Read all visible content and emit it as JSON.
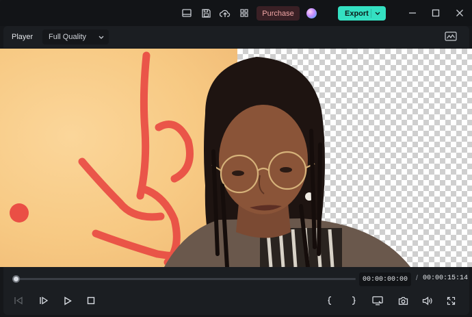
{
  "titlebar": {
    "purchase_label": "Purchase",
    "export_label": "Export",
    "icons": [
      "layout-icon",
      "save-icon",
      "cloud-upload-icon",
      "grid-icon",
      "avatar-orb-icon"
    ],
    "window_controls": [
      "minimize-icon",
      "maximize-icon",
      "close-icon"
    ]
  },
  "player": {
    "label": "Player",
    "quality": "Full Quality"
  },
  "preview": {
    "description_icon": "background-removed-preview"
  },
  "playback": {
    "current_time": "00:00:00:00",
    "separator": "/",
    "total_time": "00:00:15:14",
    "progress_fraction": 0.0
  },
  "colors": {
    "accent": "#34e0c2",
    "purchase_bg": "#3a2025",
    "purchase_text": "#f2a6a6",
    "panel": "#1b1e22"
  }
}
